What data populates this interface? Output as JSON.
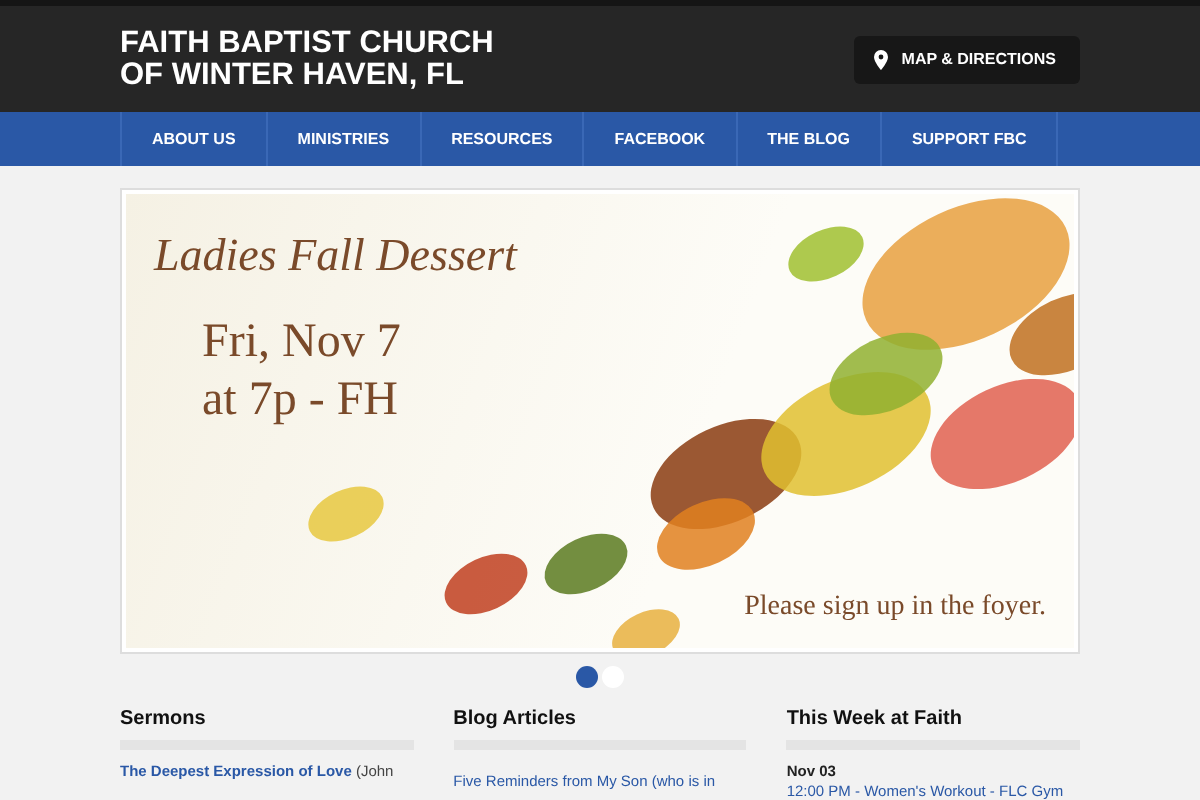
{
  "header": {
    "title_lines": [
      "FAITH BAPTIST CHURCH",
      "OF WINTER HAVEN, FL"
    ],
    "map_button": "MAP & DIRECTIONS"
  },
  "nav": [
    {
      "label": "ABOUT US"
    },
    {
      "label": "MINISTRIES"
    },
    {
      "label": "RESOURCES"
    },
    {
      "label": "FACEBOOK"
    },
    {
      "label": "THE BLOG"
    },
    {
      "label": "SUPPORT FBC"
    }
  ],
  "slider": {
    "banner": {
      "script_title": "Ladies Fall Dessert",
      "date_lines": [
        "Fri, Nov 7",
        "at 7p - FH"
      ],
      "note": "Please sign up in the foyer."
    },
    "dots": [
      {
        "selected": true
      },
      {
        "selected": false
      }
    ]
  },
  "columns": [
    {
      "heading": "Sermons",
      "kind": "sermon",
      "link": "The Deepest Expression of Love",
      "text": "(John"
    },
    {
      "heading": "Blog Articles",
      "kind": "blog",
      "link": "Five Reminders from My Son (who is in"
    },
    {
      "heading": "This Week at Faith",
      "kind": "event",
      "date": "Nov 03",
      "link": "12:00 PM - Women's Workout - FLC Gym"
    }
  ]
}
